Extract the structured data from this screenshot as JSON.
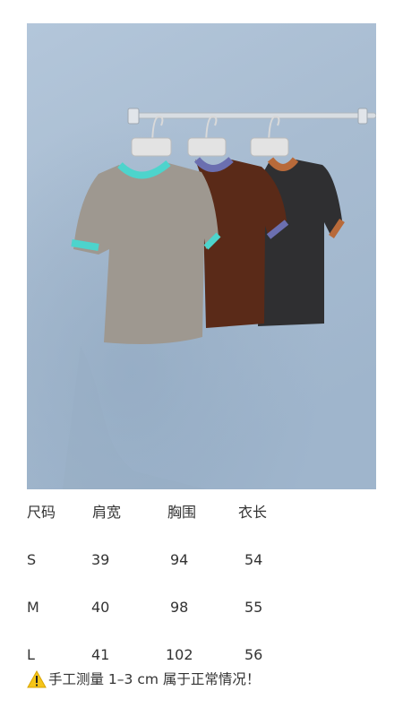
{
  "product_image": {
    "alt": "Three short-sleeve knit tops on hangers against a blue wall",
    "colors": {
      "wall": "#a9bdd2",
      "sweater_grey": "#9e9890",
      "trim_teal": "#4dd4cc",
      "sweater_brown": "#5a2a18",
      "trim_lilac": "#6b6fb0",
      "sweater_charcoal": "#2f2f31",
      "trim_orange": "#b86a3a"
    }
  },
  "size_table": {
    "headers": [
      "尺码",
      "肩宽",
      "胸围",
      "衣长"
    ],
    "rows": [
      [
        "S",
        "39",
        "94",
        "54"
      ],
      [
        "M",
        "40",
        "98",
        "55"
      ],
      [
        "L",
        "41",
        "102",
        "56"
      ]
    ]
  },
  "note": {
    "icon": "warning-icon",
    "text": "手工测量 1–3 cm  属于正常情况！"
  }
}
